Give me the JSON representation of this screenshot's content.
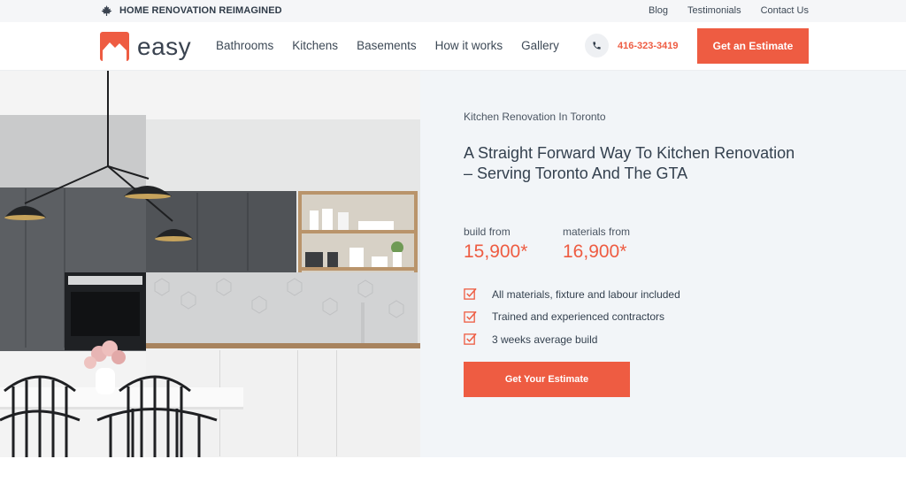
{
  "topbar": {
    "tagline": "HOME RENOVATION REIMAGINED",
    "links": [
      "Blog",
      "Testimonials",
      "Contact Us"
    ]
  },
  "header": {
    "logo_text": "easy",
    "nav": [
      "Bathrooms",
      "Kitchens",
      "Basements",
      "How it works",
      "Gallery"
    ],
    "phone": "416-323-3419",
    "cta": "Get an Estimate"
  },
  "hero": {
    "eyebrow": "Kitchen Renovation In Toronto",
    "headline": "A Straight Forward Way To Kitchen Renovation – Serving Toronto And The GTA",
    "prices": [
      {
        "label": "build from",
        "value": "15,900*"
      },
      {
        "label": "materials from",
        "value": "16,900*"
      }
    ],
    "features": [
      "All materials, fixture and labour included",
      "Trained and experienced contractors",
      "3 weeks average build"
    ],
    "cta": "Get Your Estimate"
  },
  "colors": {
    "accent": "#ee5c42",
    "text": "#2f3b48",
    "panel": "#f2f5f8"
  },
  "icons": [
    "maple-leaf-icon",
    "phone-icon",
    "checkbox-icon"
  ]
}
